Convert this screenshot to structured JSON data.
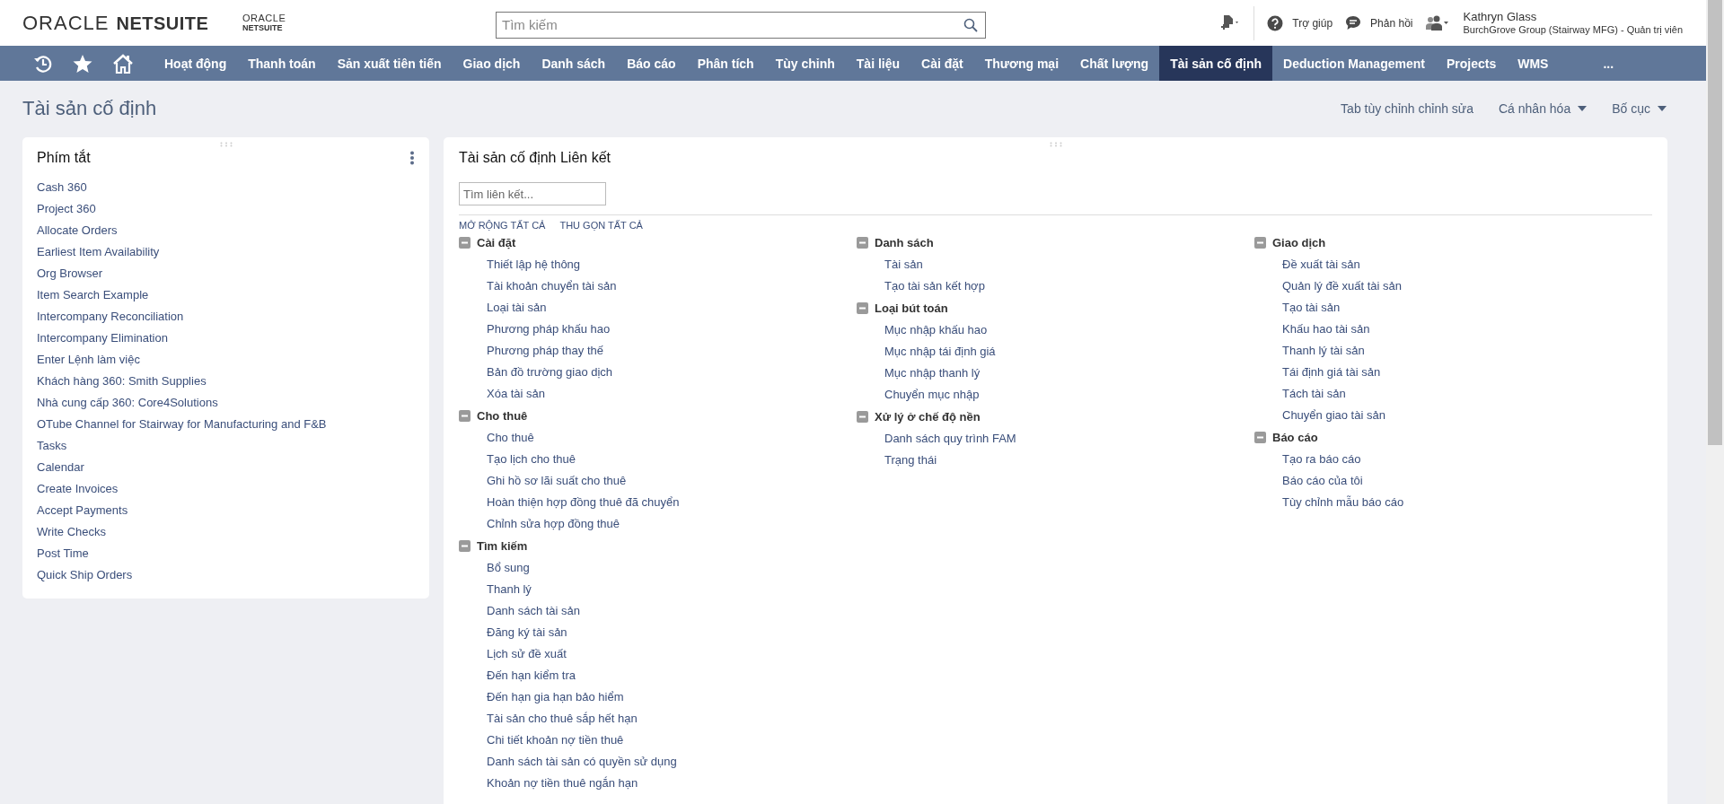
{
  "header": {
    "logo": {
      "brand": "ORACLE",
      "product": "NETSUITE"
    },
    "sub_logo": {
      "brand": "ORACLE",
      "product": "NETSUITE"
    },
    "search": {
      "placeholder": "Tìm kiếm"
    },
    "help": "Trợ giúp",
    "feedback": "Phản hồi",
    "user": {
      "name": "Kathryn Glass",
      "role": "BurchGrove Group (Stairway MFG) - Quản trị viên"
    }
  },
  "nav": {
    "tabs": [
      {
        "label": "Hoạt động",
        "selected": false
      },
      {
        "label": "Thanh toán",
        "selected": false
      },
      {
        "label": "Sản xuất tiên tiến",
        "selected": false
      },
      {
        "label": "Giao dịch",
        "selected": false
      },
      {
        "label": "Danh sách",
        "selected": false
      },
      {
        "label": "Báo cáo",
        "selected": false
      },
      {
        "label": "Phân tích",
        "selected": false
      },
      {
        "label": "Tùy chỉnh",
        "selected": false
      },
      {
        "label": "Tài liệu",
        "selected": false
      },
      {
        "label": "Cài đặt",
        "selected": false
      },
      {
        "label": "Thương mại",
        "selected": false
      },
      {
        "label": "Chất lượng",
        "selected": false
      },
      {
        "label": "Tài sản cố định",
        "selected": true
      },
      {
        "label": "Deduction Management",
        "selected": false
      },
      {
        "label": "Projects",
        "selected": false
      },
      {
        "label": "WMS",
        "selected": false
      }
    ],
    "more": "..."
  },
  "page": {
    "title": "Tài sản cố định",
    "actions": [
      {
        "label": "Tab tùy chỉnh chỉnh sửa",
        "kind": "link"
      },
      {
        "label": "Cá nhân hóa",
        "kind": "menu"
      },
      {
        "label": "Bố cục",
        "kind": "menu"
      }
    ]
  },
  "shortcuts": {
    "title": "Phím tắt",
    "items": [
      "Cash 360",
      "Project 360",
      "Allocate Orders",
      "Earliest Item Availability",
      "Org Browser",
      "Item Search Example",
      "Intercompany Reconciliation",
      "Intercompany Elimination",
      "Enter Lệnh làm việc",
      "Khách hàng 360: Smith Supplies",
      "Nhà cung cấp 360: Core4Solutions",
      "OTube Channel for Stairway for Manufacturing and F&B",
      "Tasks",
      "Calendar",
      "Create Invoices",
      "Accept Payments",
      "Write Checks",
      "Post Time",
      "Quick Ship Orders"
    ]
  },
  "links": {
    "title": "Tài sản cố định Liên kết",
    "search": {
      "placeholder": "Tìm liên kết..."
    },
    "expand_all": "MỞ RỘNG TẤT CẢ",
    "collapse_all": "THU GỌN TẤT CẢ",
    "columns": [
      [
        {
          "label": "Cài đặt",
          "expanded": true,
          "children": [
            {
              "label": "Thiết lập hệ thông"
            },
            {
              "label": "Tài khoản chuyển tài sản"
            },
            {
              "label": "Loại tài sản"
            },
            {
              "label": "Phương pháp khấu hao"
            },
            {
              "label": "Phương pháp thay thế"
            },
            {
              "label": "Bản đồ trường giao dịch"
            },
            {
              "label": "Xóa tài sản"
            }
          ]
        },
        {
          "label": "Cho thuê",
          "expanded": true,
          "children": [
            {
              "label": "Cho thuê"
            },
            {
              "label": "Tạo lịch cho thuê"
            },
            {
              "label": "Ghi hồ sơ lãi suất cho thuê"
            },
            {
              "label": "Hoàn thiện hợp đồng thuê đã chuyển"
            },
            {
              "label": "Chỉnh sửa hợp đồng thuê"
            }
          ]
        },
        {
          "label": "Tìm kiếm",
          "expanded": true,
          "children": [
            {
              "label": "Bổ sung"
            },
            {
              "label": "Thanh lý"
            },
            {
              "label": "Danh sách tài sản"
            },
            {
              "label": "Đăng ký tài sản"
            },
            {
              "label": "Lịch sử đề xuất"
            },
            {
              "label": "Đến hạn kiểm tra"
            },
            {
              "label": "Đến hạn gia hạn bảo hiểm"
            },
            {
              "label": "Tài sản cho thuê sắp hết hạn"
            },
            {
              "label": "Chi tiết khoản nợ tiền thuê"
            },
            {
              "label": "Danh sách tài sản có quyền sử dụng"
            },
            {
              "label": "Khoản nợ tiền thuê ngắn hạn"
            }
          ]
        }
      ],
      [
        {
          "label": "Danh sách",
          "expanded": true,
          "children": [
            {
              "label": "Tài sản"
            },
            {
              "label": "Tạo tài sản kết hợp"
            }
          ]
        },
        {
          "label": "Loại bút toán",
          "expanded": true,
          "children": [
            {
              "label": "Mục nhập khấu hao"
            },
            {
              "label": "Mục nhập tái định giá"
            },
            {
              "label": "Mục nhập thanh lý"
            },
            {
              "label": "Chuyển mục nhập"
            }
          ]
        },
        {
          "label": "Xử lý ở chế độ nền",
          "expanded": true,
          "children": [
            {
              "label": "Danh sách quy trình FAM"
            },
            {
              "label": "Trạng thái"
            }
          ]
        }
      ],
      [
        {
          "label": "Giao dịch",
          "expanded": true,
          "children": [
            {
              "label": "Đề xuất tài sản"
            },
            {
              "label": "Quản lý đề xuất tài sản"
            },
            {
              "label": "Tạo tài sản"
            },
            {
              "label": "Khấu hao tài sản"
            },
            {
              "label": "Thanh lý tài sản"
            },
            {
              "label": "Tái định giá tài sản"
            },
            {
              "label": "Tách tài sản"
            },
            {
              "label": "Chuyển giao tài sản"
            }
          ]
        },
        {
          "label": "Báo cáo",
          "expanded": true,
          "children": [
            {
              "label": "Tạo ra báo cáo"
            },
            {
              "label": "Báo cáo của tôi"
            },
            {
              "label": "Tùy chỉnh mẫu báo cáo"
            }
          ]
        }
      ]
    ]
  }
}
